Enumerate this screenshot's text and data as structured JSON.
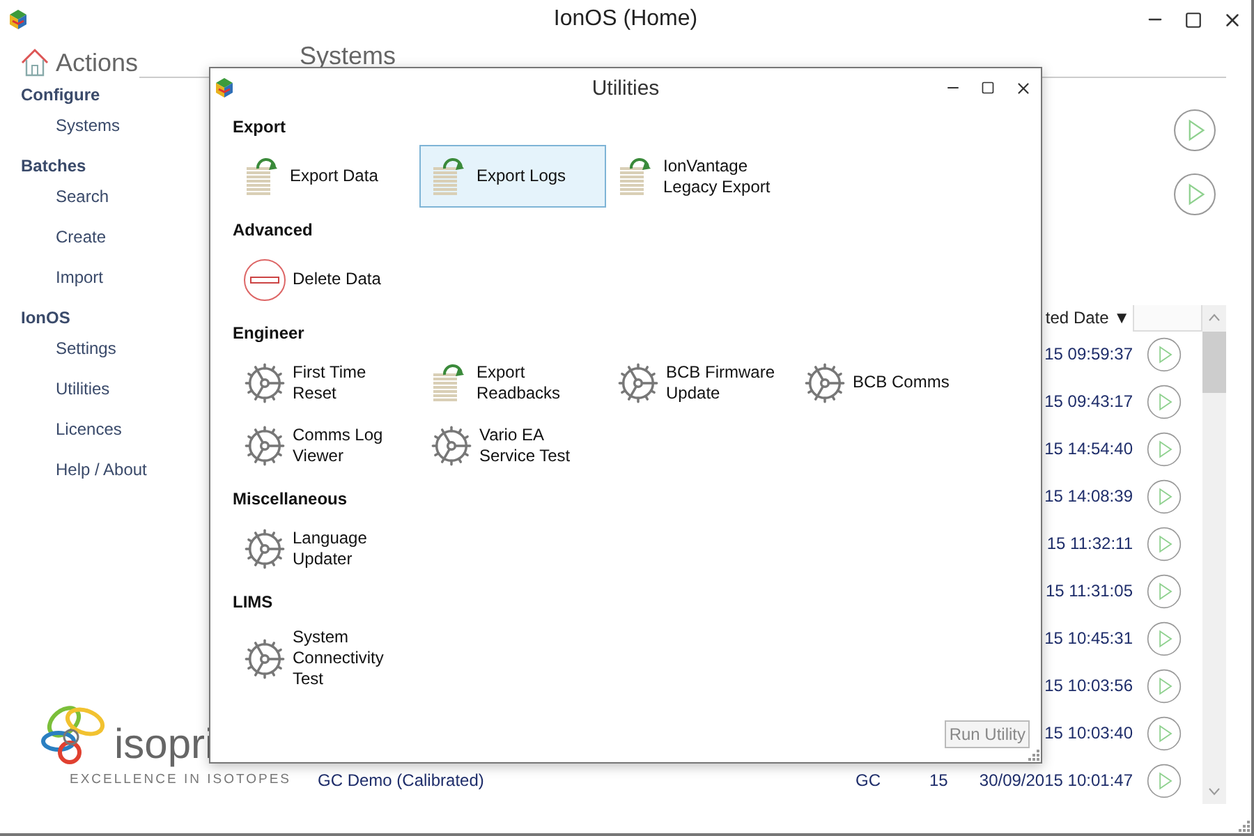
{
  "window": {
    "title": "IonOS (Home)"
  },
  "sidebar": {
    "heading": "Actions",
    "groups": [
      {
        "label": "Configure",
        "items": [
          "Systems"
        ]
      },
      {
        "label": "Batches",
        "items": [
          "Search",
          "Create",
          "Import"
        ]
      },
      {
        "label": "IonOS",
        "items": [
          "Settings",
          "Utilities",
          "Licences",
          "Help / About"
        ]
      }
    ]
  },
  "main_heading": "Systems",
  "table": {
    "columns": [
      "ted Date ▼"
    ],
    "rows": [
      {
        "date": "15 09:59:37"
      },
      {
        "date": "15 09:43:17"
      },
      {
        "date": "15 14:54:40"
      },
      {
        "date": "15 14:08:39"
      },
      {
        "date": "15 11:32:11"
      },
      {
        "date": "15 11:31:05"
      },
      {
        "date": "15 10:45:31"
      },
      {
        "date": "15 10:03:56"
      },
      {
        "date": "15 10:03:40"
      },
      {
        "name": "GC Demo (Calibrated)",
        "type": "GC",
        "count": "15",
        "date": "30/09/2015 10:01:47"
      }
    ]
  },
  "logo": {
    "name": "isopri",
    "tagline": "EXCELLENCE IN ISOTOPES"
  },
  "dialog": {
    "title": "Utilities",
    "sections": [
      {
        "heading": "Export",
        "items": [
          {
            "label": "Export Data",
            "kind": "export",
            "selected": false
          },
          {
            "label": "Export Logs",
            "kind": "export",
            "selected": true
          },
          {
            "label": "IonVantage\nLegacy Export",
            "kind": "export",
            "selected": false
          }
        ]
      },
      {
        "heading": "Advanced",
        "items": [
          {
            "label": "Delete Data",
            "kind": "delete",
            "selected": false
          }
        ]
      },
      {
        "heading": "Engineer",
        "items": [
          {
            "label": "First Time\nReset",
            "kind": "gear",
            "selected": false
          },
          {
            "label": "Export\nReadbacks",
            "kind": "export",
            "selected": false
          },
          {
            "label": "BCB Firmware\nUpdate",
            "kind": "gear",
            "selected": false
          },
          {
            "label": "BCB Comms",
            "kind": "gear",
            "selected": false
          },
          {
            "label": "Comms Log\nViewer",
            "kind": "gear",
            "selected": false
          },
          {
            "label": "Vario EA\nService Test",
            "kind": "gear",
            "selected": false
          }
        ]
      },
      {
        "heading": "Miscellaneous",
        "items": [
          {
            "label": "Language\nUpdater",
            "kind": "gear",
            "selected": false
          }
        ]
      },
      {
        "heading": "LIMS",
        "items": [
          {
            "label": "System\nConnectivity\nTest",
            "kind": "gear",
            "selected": false
          }
        ]
      }
    ],
    "run_button": {
      "label": "Run Utility",
      "disabled": true
    }
  }
}
